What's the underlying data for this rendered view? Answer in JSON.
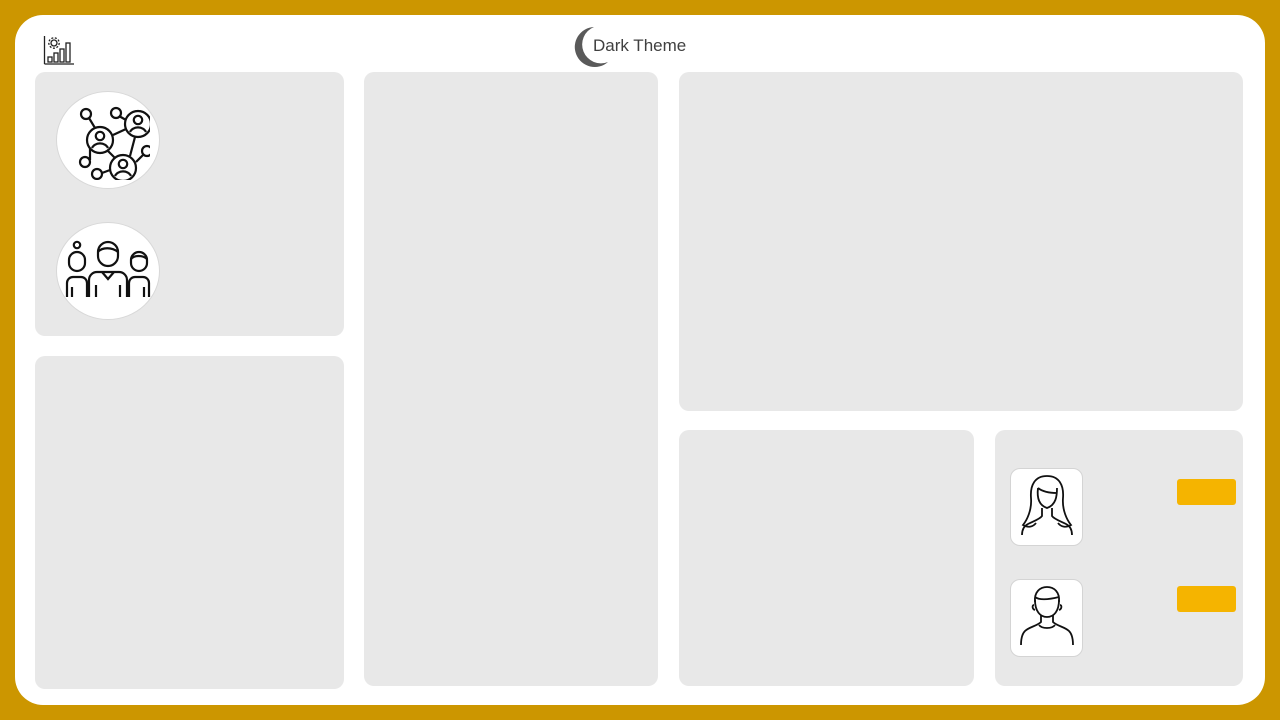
{
  "header": {
    "logo_icon": "analytics-chart-gear-icon",
    "theme_toggle": {
      "icon": "moon-icon",
      "label": "Dark Theme"
    }
  },
  "panels": {
    "top_left": {
      "icons": [
        "network-people-icon",
        "team-icon"
      ]
    },
    "bottom_right": {
      "people": [
        {
          "avatar": "female-avatar-icon",
          "button_color": "#f5b400"
        },
        {
          "avatar": "male-avatar-icon",
          "button_color": "#f5b400"
        }
      ]
    }
  },
  "colors": {
    "border": "#cc9600",
    "panel": "#e8e8e8",
    "accent": "#f5b400",
    "background": "#ffffff"
  }
}
